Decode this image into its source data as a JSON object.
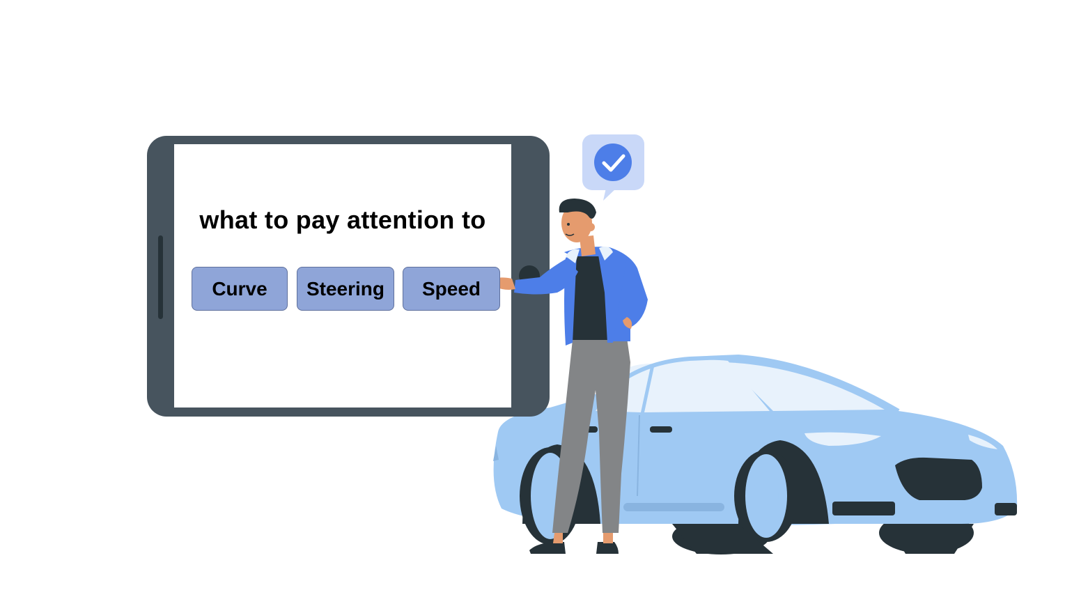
{
  "screen": {
    "title": "what to pay attention to",
    "options": [
      {
        "label": "Curve"
      },
      {
        "label": "Steering"
      },
      {
        "label": "Speed"
      }
    ]
  },
  "icons": {
    "speech_bubble": "check-circle-icon"
  },
  "colors": {
    "tablet_frame": "#47545e",
    "option_button": "#8fa5d8",
    "car_body": "#9fc9f3",
    "jacket": "#4d7ee8",
    "check_badge": "#4d7ee8"
  }
}
